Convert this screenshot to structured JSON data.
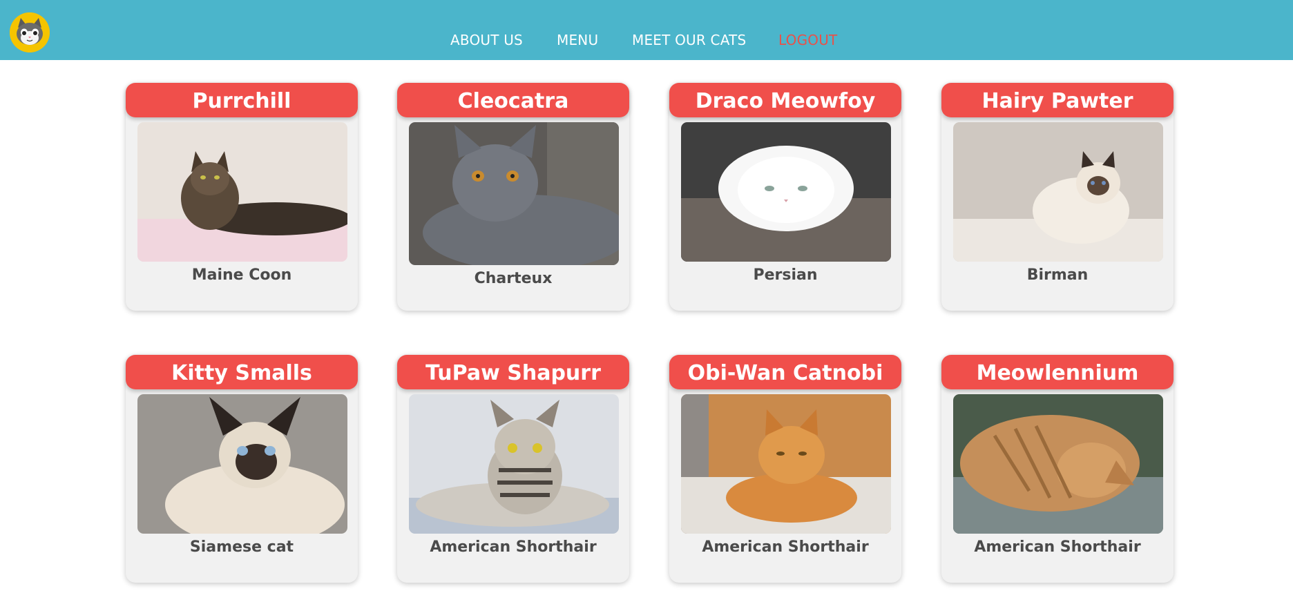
{
  "nav": {
    "logo_icon": "cat-face-logo-icon",
    "links": [
      {
        "label": "ABOUT US"
      },
      {
        "label": "MENU"
      },
      {
        "label": "MEET OUR CATS"
      },
      {
        "label": "LOGOUT"
      }
    ],
    "colors": {
      "bar": "#4bb5cb",
      "link": "#ffffff",
      "logout": "#e8524a"
    }
  },
  "cats": [
    {
      "name": "Purrchill",
      "breed": "Maine Coon",
      "photo_icon": "maine-coon-photo"
    },
    {
      "name": "Cleocatra",
      "breed": "Charteux",
      "photo_icon": "charteux-photo"
    },
    {
      "name": "Draco Meowfoy",
      "breed": "Persian",
      "photo_icon": "persian-photo"
    },
    {
      "name": "Hairy Pawter",
      "breed": "Birman",
      "photo_icon": "birman-photo"
    },
    {
      "name": "Kitty Smalls",
      "breed": "Siamese cat",
      "photo_icon": "siamese-photo"
    },
    {
      "name": "TuPaw Shapurr",
      "breed": "American Shorthair",
      "photo_icon": "tabby-silver-photo"
    },
    {
      "name": "Obi-Wan Catnobi",
      "breed": "American Shorthair",
      "photo_icon": "orange-tabby-photo"
    },
    {
      "name": "Meowlennium",
      "breed": "American Shorthair",
      "photo_icon": "orange-rolling-photo"
    }
  ],
  "colors": {
    "card_title": "#f04f4b",
    "card_bg": "#f1f1f1",
    "breed_text": "#4a4a4a"
  }
}
